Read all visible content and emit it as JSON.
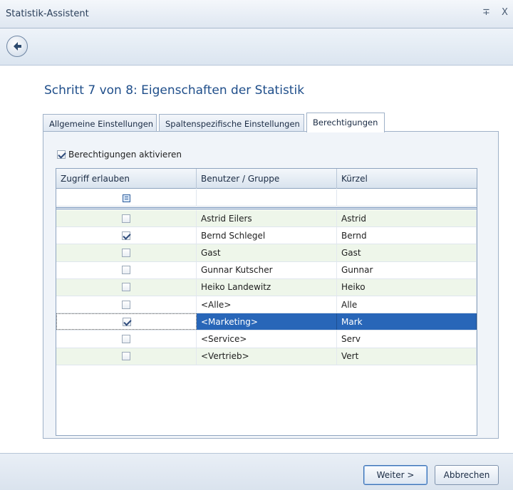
{
  "window": {
    "title": "Statistik-Assistent",
    "pin_glyph": "∓",
    "close_glyph": "X"
  },
  "nav": {
    "back_icon": "back-arrow-icon"
  },
  "step": {
    "title": "Schritt 7 von 8: Eigenschaften der Statistik"
  },
  "tabs": [
    {
      "label": "Allgemeine Einstellungen",
      "active": false
    },
    {
      "label": "Spaltenspezifische Einstellungen",
      "active": false
    },
    {
      "label": "Berechtigungen",
      "active": true
    }
  ],
  "permissions": {
    "activate_label": "Berechtigungen aktivieren",
    "activate_checked": true
  },
  "grid": {
    "columns": [
      "Zugriff erlauben",
      "Benutzer / Gruppe",
      "Kürzel"
    ],
    "rows": [
      {
        "allowed": false,
        "user": "Astrid Eilers",
        "short": "Astrid"
      },
      {
        "allowed": true,
        "user": "Bernd Schlegel",
        "short": "Bernd"
      },
      {
        "allowed": false,
        "user": "Gast",
        "short": "Gast"
      },
      {
        "allowed": false,
        "user": "Gunnar Kutscher",
        "short": "Gunnar"
      },
      {
        "allowed": false,
        "user": "Heiko Landewitz",
        "short": "Heiko"
      },
      {
        "allowed": false,
        "user": "<Alle>",
        "short": "Alle"
      },
      {
        "allowed": true,
        "user": "<Marketing>",
        "short": "Mark",
        "selected": true
      },
      {
        "allowed": false,
        "user": "<Service>",
        "short": "Serv"
      },
      {
        "allowed": false,
        "user": "<Vertrieb>",
        "short": "Vert"
      }
    ]
  },
  "footer": {
    "next_label": "Weiter >",
    "cancel_label": "Abbrechen"
  },
  "colors": {
    "accent": "#1f4e8a",
    "selection": "#2866b8",
    "row_alt": "#eef6ea"
  }
}
